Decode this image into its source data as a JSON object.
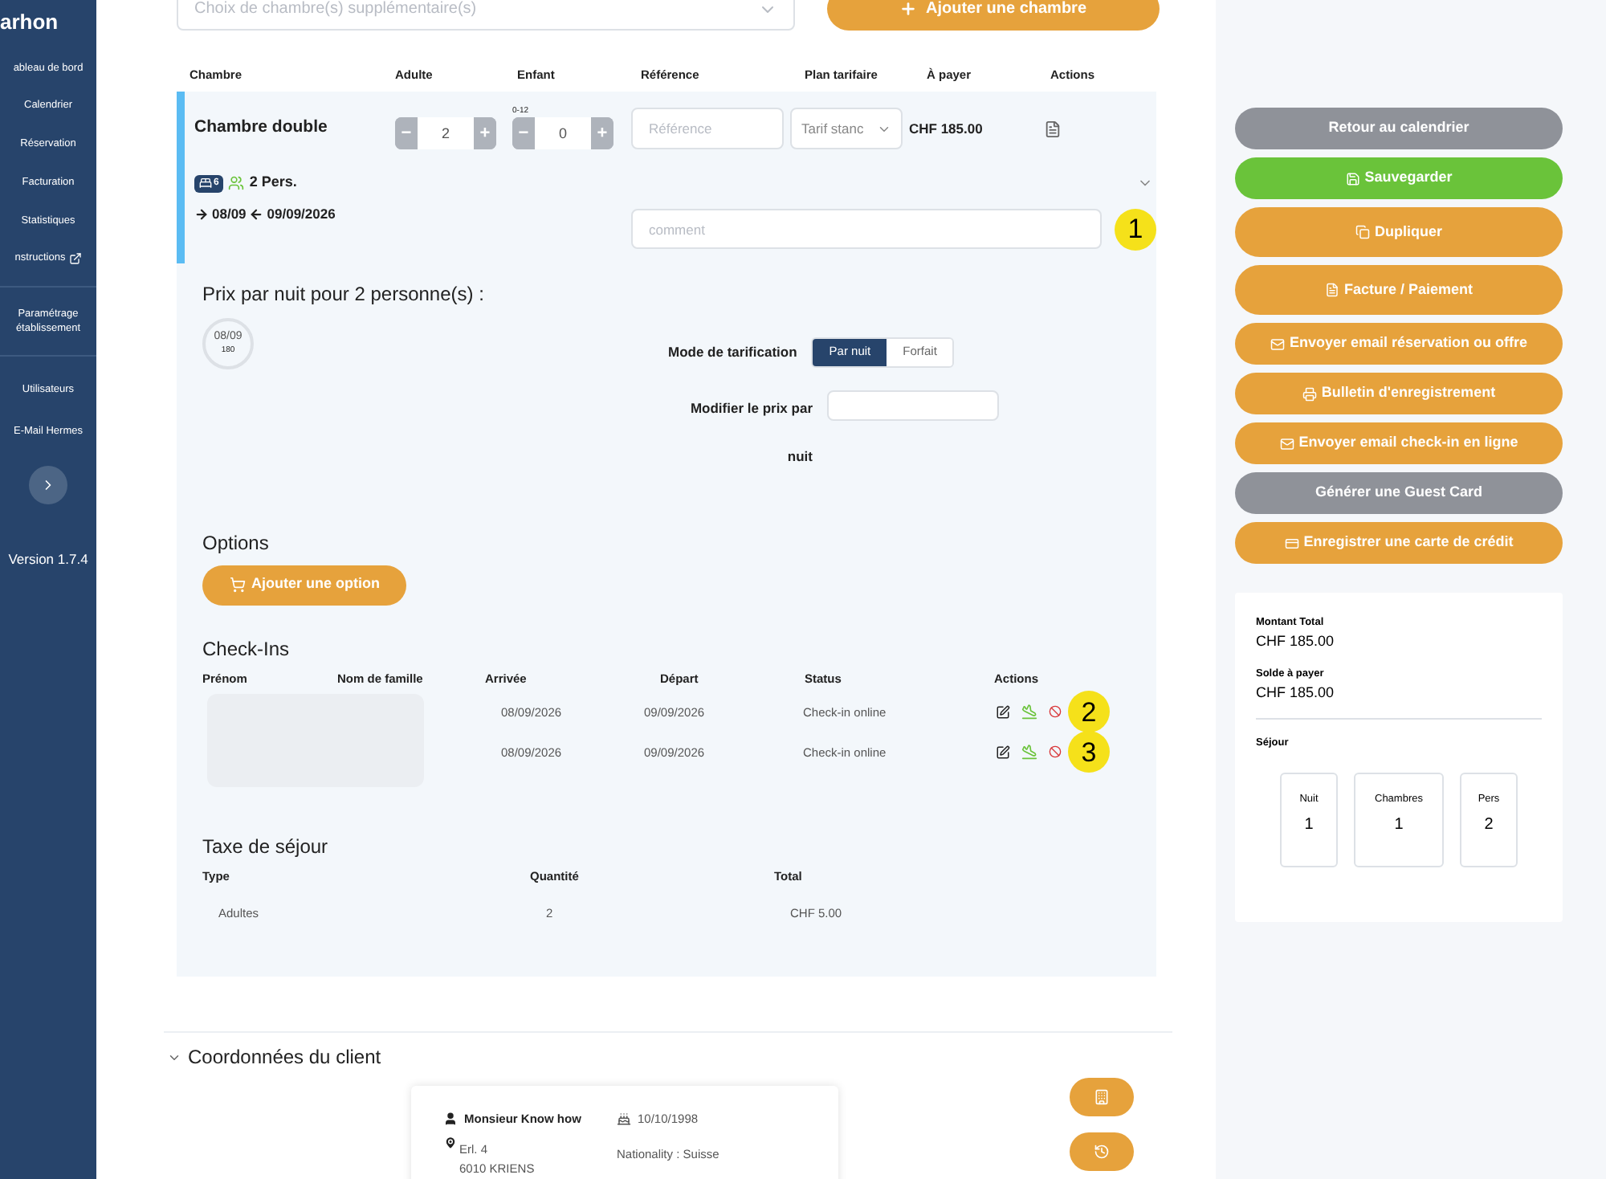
{
  "sidebar": {
    "logo": "arhon",
    "items": [
      {
        "label": "ableau de bord",
        "external": false
      },
      {
        "label": "Calendrier",
        "external": false
      },
      {
        "label": "Réservation",
        "external": false
      },
      {
        "label": "Facturation",
        "external": false
      },
      {
        "label": "Statistiques",
        "external": false
      },
      {
        "label": "nstructions",
        "external": true
      }
    ],
    "settings_items": [
      {
        "label": "Paramétrage établissement"
      }
    ],
    "admin_items": [
      {
        "label": "Utilisateurs"
      },
      {
        "label": "E-Mail Hermes"
      }
    ],
    "version": "Version 1.7.4"
  },
  "room_picker": {
    "placeholder": "Choix de chambre(s) supplémentaire(s)",
    "button": "Ajouter une chambre"
  },
  "stepper_signs": {
    "minus": "−",
    "plus": "+"
  },
  "rooms_table": {
    "columns": [
      "Chambre",
      "Adulte",
      "Enfant",
      "Référence",
      "Plan tarifaire",
      "À payer",
      "Actions"
    ],
    "room": {
      "name": "Chambre double",
      "adults": "2",
      "child_age": "0-12",
      "children": "0",
      "reference_placeholder": "Référence",
      "rate_plan": "Tarif stanc",
      "amount": "CHF 185.00",
      "beds": "6",
      "persons": "2 Pers.",
      "arrival": "08/09",
      "departure": "09/09/2026",
      "comment_placeholder": "comment",
      "expanded": false
    }
  },
  "pricing": {
    "title": "Prix par nuit pour 2 personne(s) :",
    "nights": [
      {
        "date": "08/09",
        "price": "180"
      }
    ],
    "mode_label": "Mode de tarification",
    "modes": [
      {
        "label": "Par nuit",
        "selected": true
      },
      {
        "label": "Forfait",
        "selected": false
      }
    ],
    "modify_label": "Modifier le prix par nuit"
  },
  "options": {
    "title": "Options",
    "button": "Ajouter une option"
  },
  "checkins": {
    "title": "Check-Ins",
    "columns": [
      "Prénom",
      "Nom de famille",
      "Arrivée",
      "Départ",
      "Status",
      "Actions"
    ],
    "rows": [
      {
        "arrival": "08/09/2026",
        "departure": "09/09/2026",
        "status": "Check-in online",
        "callout": "2"
      },
      {
        "arrival": "08/09/2026",
        "departure": "09/09/2026",
        "status": "Check-in online",
        "callout": "3"
      }
    ]
  },
  "tax": {
    "title": "Taxe de séjour",
    "columns": [
      "Type",
      "Quantité",
      "Total"
    ],
    "rows": [
      {
        "type": "Adultes",
        "quantity": "2",
        "total": "CHF 5.00"
      }
    ]
  },
  "client": {
    "title": "Coordonnées du client",
    "name": "Monsieur  Know how",
    "street": "Erl. 4",
    "city": "6010 KRIENS",
    "birthdate": "10/10/1998",
    "nationality": "Nationality : Suisse"
  },
  "comment_callout": "1",
  "actions": [
    {
      "label": "Retour au calendrier",
      "kind": "secondary"
    },
    {
      "label": "Sauvegarder",
      "kind": "success"
    },
    {
      "label": "Dupliquer",
      "kind": "primary"
    },
    {
      "label": "Facture / Paiement",
      "kind": "primary"
    },
    {
      "label": "Envoyer email réservation ou offre",
      "kind": "primary"
    },
    {
      "label": "Bulletin d'enregistrement",
      "kind": "primary"
    },
    {
      "label": "Envoyer email check-in en ligne",
      "kind": "primary"
    },
    {
      "label": "Générer une Guest Card",
      "kind": "secondary"
    },
    {
      "label": "Enregistrer une carte de crédit",
      "kind": "primary"
    }
  ],
  "summary": {
    "total_label": "Montant Total",
    "total": "CHF 185.00",
    "balance_label": "Solde à payer",
    "balance": "CHF 185.00",
    "stay_label": "Séjour",
    "stats": [
      {
        "label": "Nuit",
        "value": "1"
      },
      {
        "label": "Chambres",
        "value": "1"
      },
      {
        "label": "Pers",
        "value": "2"
      }
    ]
  }
}
